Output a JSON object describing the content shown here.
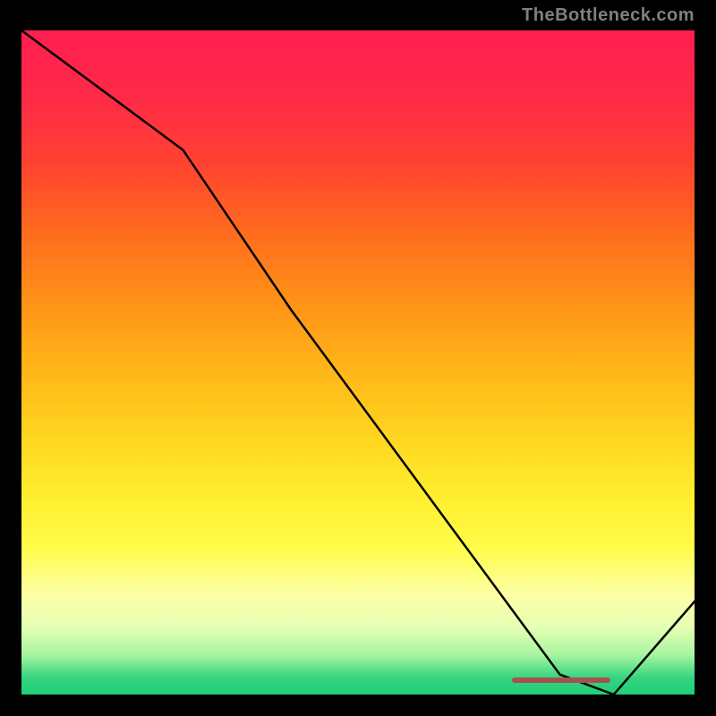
{
  "watermark": "TheBottleneck.com",
  "colors": {
    "gradient_stops": [
      {
        "offset": 0.0,
        "color": "#ff1e52"
      },
      {
        "offset": 0.1,
        "color": "#ff2a47"
      },
      {
        "offset": 0.2,
        "color": "#ff4230"
      },
      {
        "offset": 0.3,
        "color": "#ff6a1f"
      },
      {
        "offset": 0.4,
        "color": "#ff8f18"
      },
      {
        "offset": 0.5,
        "color": "#ffb218"
      },
      {
        "offset": 0.6,
        "color": "#ffd21f"
      },
      {
        "offset": 0.7,
        "color": "#ffee2e"
      },
      {
        "offset": 0.78,
        "color": "#fffc4a"
      },
      {
        "offset": 0.85,
        "color": "#fdffa6"
      },
      {
        "offset": 0.9,
        "color": "#e4ffb4"
      },
      {
        "offset": 0.94,
        "color": "#a8f5a0"
      },
      {
        "offset": 0.975,
        "color": "#35d47f"
      },
      {
        "offset": 1.0,
        "color": "#1ecf7a"
      }
    ],
    "line": "#000000",
    "marker": "#a85050"
  },
  "chart_data": {
    "type": "line",
    "title": "",
    "xlabel": "",
    "ylabel": "",
    "xlim": [
      0,
      100
    ],
    "ylim": [
      0,
      100
    ],
    "x": [
      0,
      8,
      24,
      40,
      56,
      72,
      80,
      88,
      100
    ],
    "values": [
      100,
      94,
      82,
      58,
      36,
      14,
      3,
      0,
      14
    ]
  }
}
